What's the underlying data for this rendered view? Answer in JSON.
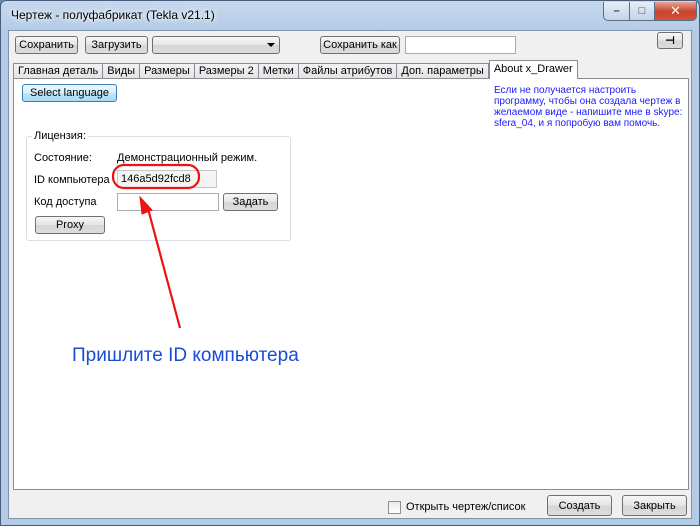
{
  "window": {
    "title": "Чертеж - полуфабрикат (Tekla v21.1)",
    "minimize_glyph": "–",
    "maximize_glyph": "□",
    "close_glyph": "✕"
  },
  "toolbar": {
    "save_label": "Сохранить",
    "load_label": "Загрузить",
    "preset_value": "",
    "save_as_label": "Сохранить как",
    "save_as_value": "",
    "pin_glyph": "⊣"
  },
  "tabs": [
    {
      "label": "Главная деталь",
      "active": false
    },
    {
      "label": "Виды",
      "active": false
    },
    {
      "label": "Размеры",
      "active": false
    },
    {
      "label": "Размеры 2",
      "active": false
    },
    {
      "label": "Метки",
      "active": false
    },
    {
      "label": "Файлы атрибутов",
      "active": false
    },
    {
      "label": "Доп. параметры",
      "active": false
    },
    {
      "label": "About x_Drawer",
      "active": true
    }
  ],
  "about": {
    "select_language_label": "Select language",
    "help_text": "Если не получается настроить программу, чтобы она создала чертеж в желаемом виде - напишите мне в skype: sfera_04, и я попробую вам помочь.",
    "license": {
      "legend": "Лицензия:",
      "state_label": "Состояние:",
      "state_value": "Демонстрационный режим.",
      "computer_id_label": "ID компьютера",
      "computer_id_value": "146a5d92fcd8",
      "access_code_label": "Код доступа",
      "access_code_value": "",
      "set_button_label": "Задать",
      "proxy_button_label": "Proxy"
    }
  },
  "annotation": {
    "text": "Пришлите ID компьютера",
    "color": "#ee1111"
  },
  "footer": {
    "open_checkbox_label": "Открыть чертеж/список",
    "open_checkbox_checked": false,
    "create_label": "Создать",
    "close_label": "Закрыть"
  }
}
